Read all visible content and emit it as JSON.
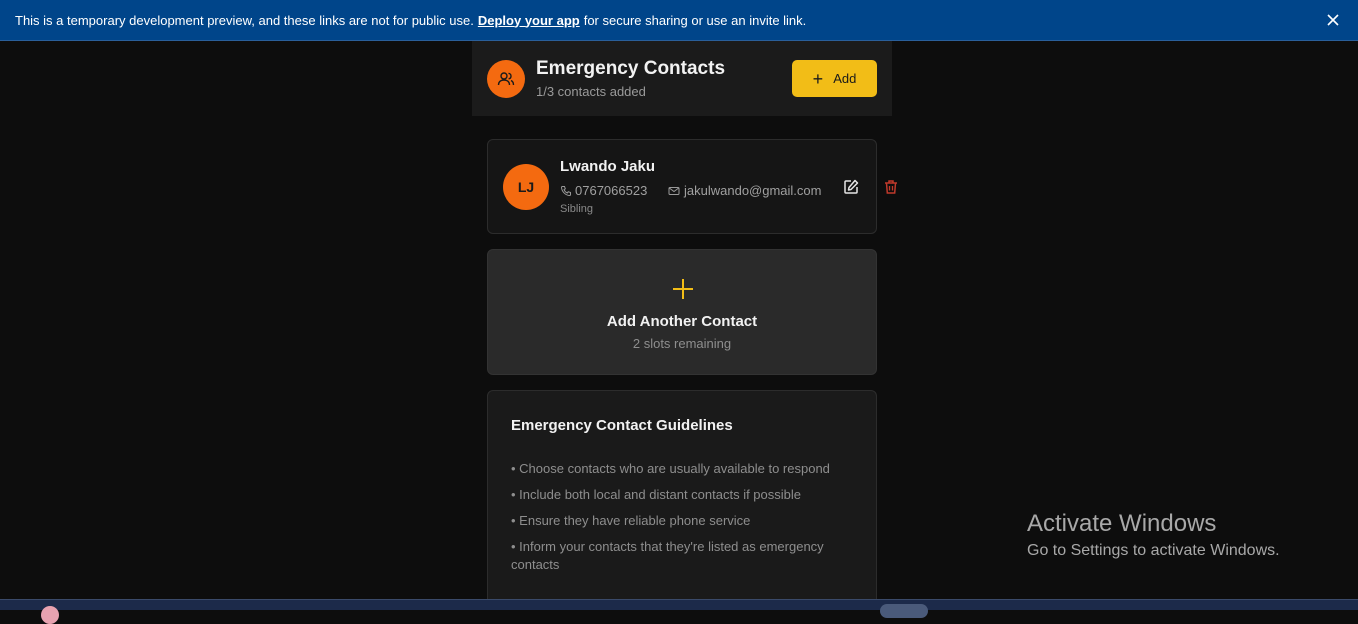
{
  "banner": {
    "text_before": "This is a temporary development preview, and these links are not for public use.",
    "link_text": "Deploy your app",
    "text_after": "for secure sharing or use an invite link."
  },
  "header": {
    "title": "Emergency Contacts",
    "subtitle": "1/3 contacts added",
    "add_button_label": "Add"
  },
  "contacts": [
    {
      "initials": "LJ",
      "name": "Lwando Jaku",
      "phone": "0767066523",
      "email": "jakulwando@gmail.com",
      "relationship": "Sibling"
    }
  ],
  "add_another": {
    "label": "Add Another Contact",
    "sub": "2 slots remaining"
  },
  "guidelines": {
    "title": "Emergency Contact Guidelines",
    "items": [
      "• Choose contacts who are usually available to respond",
      "• Include both local and distant contacts if possible",
      "• Ensure they have reliable phone service",
      "• Inform your contacts that they're listed as emergency contacts"
    ]
  },
  "watermark": {
    "line1": "Activate Windows",
    "line2": "Go to Settings to activate Windows."
  },
  "colors": {
    "accent_orange": "#f46a10",
    "accent_yellow": "#f2bd17",
    "banner_blue": "#00458a",
    "delete_red": "#c0392b"
  }
}
